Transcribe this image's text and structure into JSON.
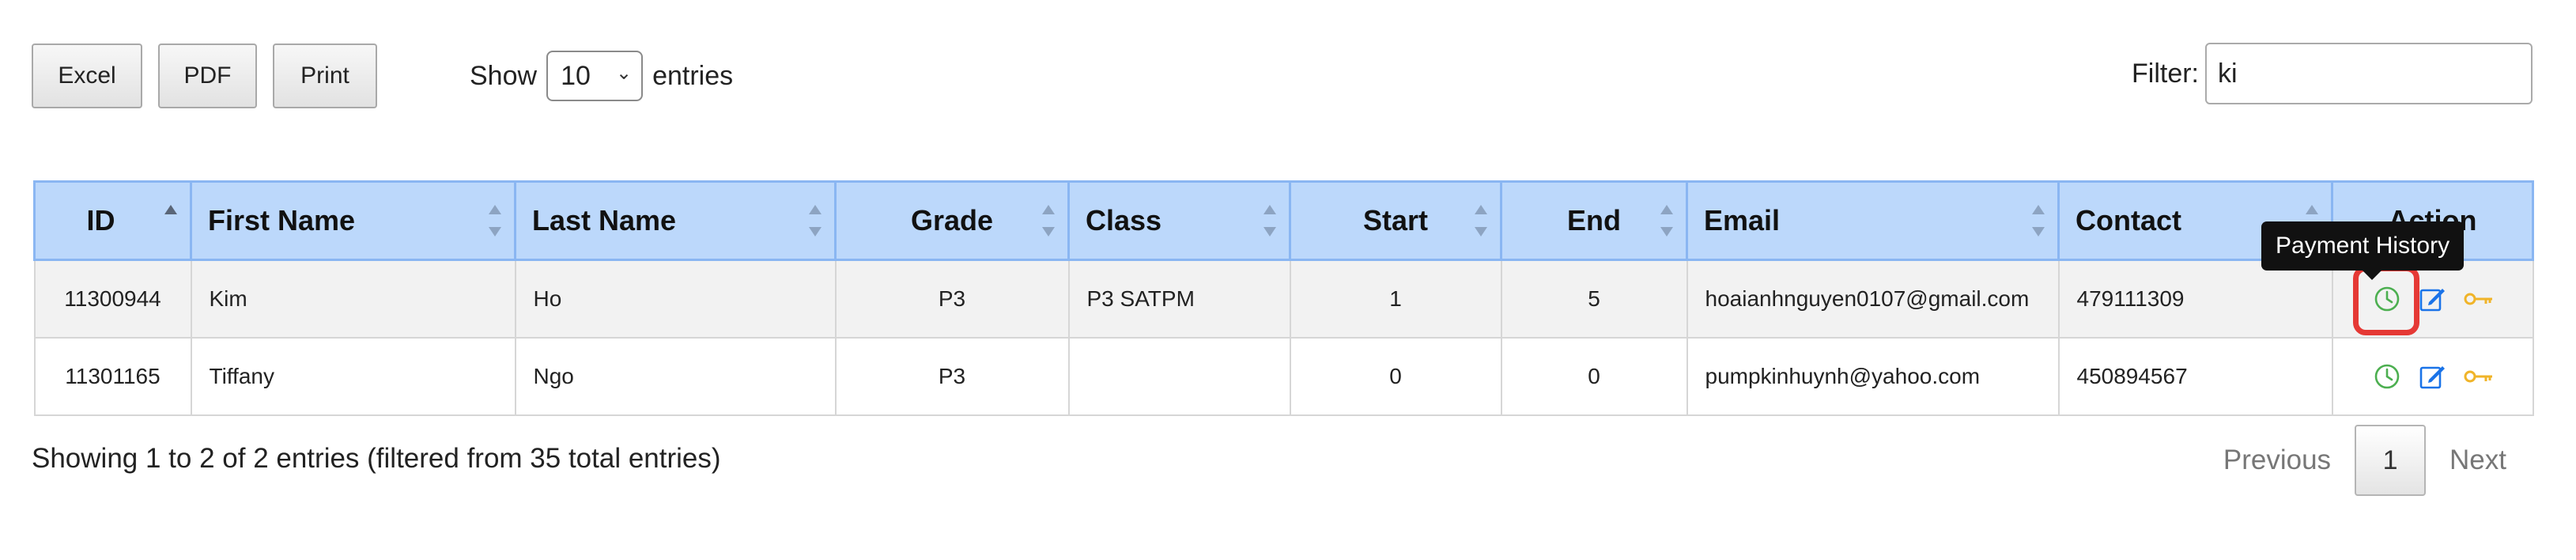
{
  "toolbar": {
    "excel": "Excel",
    "pdf": "PDF",
    "print": "Print"
  },
  "length": {
    "show": "Show",
    "value": "10",
    "entries": "entries"
  },
  "filter": {
    "label": "Filter:",
    "value": "ki"
  },
  "columns": [
    "ID",
    "First Name",
    "Last Name",
    "Grade",
    "Class",
    "Start",
    "End",
    "Email",
    "Contact",
    "Action"
  ],
  "rows": [
    {
      "id": "11300944",
      "first": "Kim",
      "last": "Ho",
      "grade": "P3",
      "class": "P3 SATPM",
      "start": "1",
      "end": "5",
      "email": "hoaianhnguyen0107@gmail.com",
      "contact": "479111309"
    },
    {
      "id": "11301165",
      "first": "Tiffany",
      "last": "Ngo",
      "grade": "P3",
      "class": "",
      "start": "0",
      "end": "0",
      "email": "pumpkinhuynh@yahoo.com",
      "contact": "450894567"
    }
  ],
  "action_icons": [
    "clock-icon",
    "edit-icon",
    "key-icon"
  ],
  "tooltip": "Payment History",
  "info": "Showing 1 to 2 of 2 entries (filtered from 35 total entries)",
  "pager": {
    "previous": "Previous",
    "current": "1",
    "next": "Next"
  },
  "colors": {
    "header_bg": "#bcd8fb",
    "history_icon": "#4caf50",
    "edit_icon": "#1a73e8",
    "key_icon": "#f0b429",
    "highlight": "#e53935"
  }
}
